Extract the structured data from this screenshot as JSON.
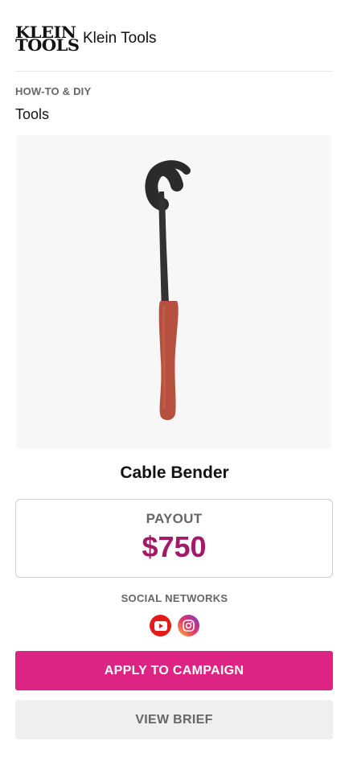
{
  "brand": {
    "logo_line1": "KLEIN",
    "logo_line2": "TOOLS",
    "name": "Klein Tools"
  },
  "category": "HOW-TO & DIY",
  "subcategory": "Tools",
  "product": {
    "title": "Cable Bender"
  },
  "payout": {
    "label": "PAYOUT",
    "value": "$750",
    "color": "#a01a68"
  },
  "social": {
    "label": "SOCIAL NETWORKS",
    "icons": [
      "youtube-icon",
      "instagram-icon"
    ]
  },
  "buttons": {
    "apply_label": "APPLY TO CAMPAIGN",
    "brief_label": "VIEW BRIEF"
  },
  "colors": {
    "accent": "#dd2383",
    "secondary_button": "#efefef"
  }
}
